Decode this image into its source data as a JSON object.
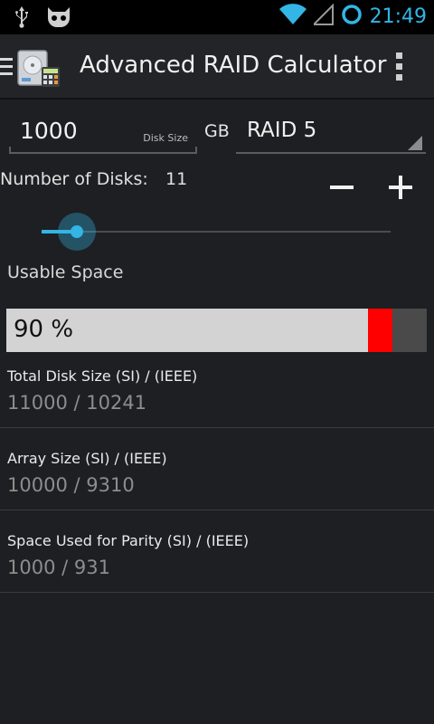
{
  "status_bar": {
    "time": "21:49",
    "icons": [
      "usb-icon",
      "android-icon",
      "wifi-icon",
      "signal-icon",
      "sync-icon"
    ],
    "accent_color": "#33b5e5"
  },
  "action_bar": {
    "title": "Advanced RAID Calculator",
    "icons": [
      "menu-icon",
      "app-icon",
      "overflow-menu-icon"
    ]
  },
  "inputs": {
    "disk_size_value": "1000",
    "disk_size_hint": "Disk Size",
    "unit": "GB",
    "raid_level": "RAID 5"
  },
  "disks": {
    "label": "Number of Disks:",
    "count": "11",
    "slider_fraction": 0.1
  },
  "usable": {
    "label": "Usable Space",
    "percent_text": "90 %",
    "data_fraction": 0.86,
    "parity_fraction": 0.058,
    "colors": {
      "data": "#d3d3d3",
      "parity": "#ff0000",
      "free": "#4a4a4a"
    }
  },
  "results": [
    {
      "label": "Total Disk Size (SI) / (IEEE)",
      "value": "11000 / 10241"
    },
    {
      "label": "Array Size (SI) / (IEEE)",
      "value": "10000 / 9310"
    },
    {
      "label": "Space Used for Parity (SI) / (IEEE)",
      "value": "1000 / 931"
    }
  ]
}
